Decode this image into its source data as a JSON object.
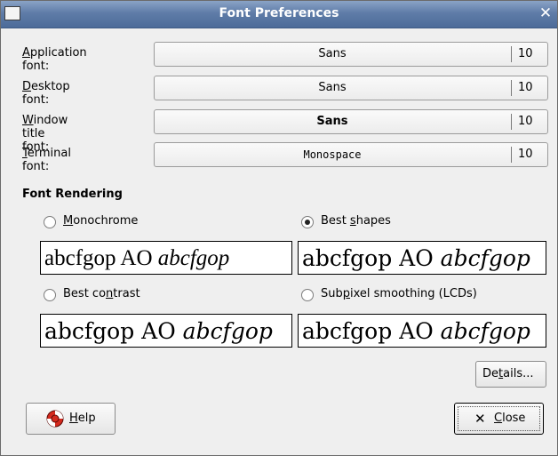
{
  "window": {
    "title": "Font Preferences"
  },
  "fonts": [
    {
      "label_pre": "",
      "label_key": "A",
      "label_post": "pplication font:",
      "name": "Sans",
      "size": "10",
      "style": "normal"
    },
    {
      "label_pre": "",
      "label_key": "D",
      "label_post": "esktop font:",
      "name": "Sans",
      "size": "10",
      "style": "normal"
    },
    {
      "label_pre": "",
      "label_key": "W",
      "label_post": "indow title font:",
      "name": "Sans",
      "size": "10",
      "style": "bold"
    },
    {
      "label_pre": "",
      "label_key": "T",
      "label_post": "erminal font:",
      "name": "Monospace",
      "size": "10",
      "style": "mono"
    }
  ],
  "rendering": {
    "title": "Font Rendering",
    "sample_plain": "abcfgop AO ",
    "sample_italic": "abcfgop",
    "options": [
      {
        "pre": "",
        "key": "M",
        "post": "onochrome",
        "selected": false
      },
      {
        "pre": "Best ",
        "key": "s",
        "post": "hapes",
        "selected": true
      },
      {
        "pre": "Best co",
        "key": "n",
        "post": "trast",
        "selected": false
      },
      {
        "pre": "Sub",
        "key": "p",
        "post": "ixel smoothing (LCDs)",
        "selected": false
      }
    ]
  },
  "buttons": {
    "details_pre": "De",
    "details_key": "t",
    "details_post": "ails...",
    "help_key": "H",
    "help_post": "elp",
    "close_key": "C",
    "close_post": "lose"
  }
}
